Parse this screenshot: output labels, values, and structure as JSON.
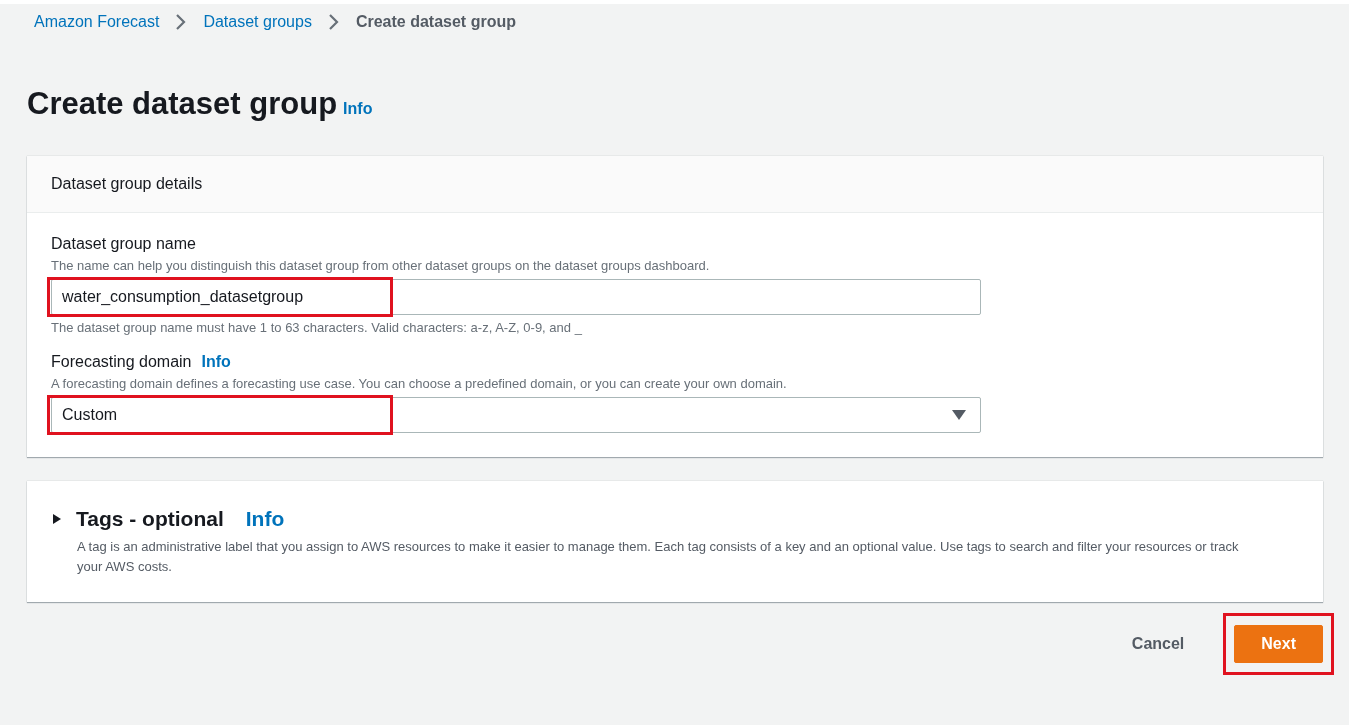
{
  "breadcrumbs": [
    {
      "label": "Amazon Forecast",
      "current": false
    },
    {
      "label": "Dataset groups",
      "current": false
    },
    {
      "label": "Create dataset group",
      "current": true
    }
  ],
  "page_title": "Create dataset group",
  "title_info": "Info",
  "details_panel": {
    "header": "Dataset group details",
    "fields": [
      {
        "kind": "text",
        "label": "Dataset group name",
        "description": "The name can help you distinguish this dataset group from other dataset groups on the dataset groups dashboard.",
        "value": "water_consumption_datasetgroup",
        "constraint": "The dataset group name must have 1 to 63 characters. Valid characters: a-z, A-Z, 0-9, and _",
        "highlighted": true
      },
      {
        "kind": "select",
        "label": "Forecasting domain",
        "info": "Info",
        "description": "A forecasting domain defines a forecasting use case. You can choose a predefined domain, or you can create your own domain.",
        "value": "Custom",
        "highlighted": true
      }
    ]
  },
  "tags_panel": {
    "title": "Tags - optional",
    "info": "Info",
    "expanded": false,
    "description": "A tag is an administrative label that you assign to AWS resources to make it easier to manage them. Each tag consists of a key and an optional value. Use tags to search and filter your resources or track your AWS costs."
  },
  "buttons": [
    {
      "kind": "link",
      "label": "Cancel"
    },
    {
      "kind": "primary",
      "label": "Next",
      "highlighted": true
    }
  ]
}
